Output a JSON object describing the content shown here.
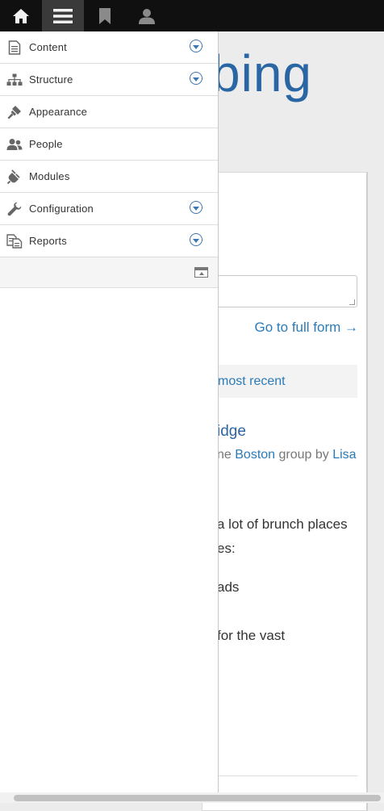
{
  "toolbar": {
    "items": [
      {
        "name": "home",
        "icon": "home-icon"
      },
      {
        "name": "manage",
        "icon": "hamburger-menu-icon"
      },
      {
        "name": "shortcuts",
        "icon": "bookmark-icon"
      },
      {
        "name": "user",
        "icon": "user-icon"
      }
    ]
  },
  "tray": {
    "items": [
      {
        "label": "Content",
        "icon": "document-icon",
        "has_children": true
      },
      {
        "label": "Structure",
        "icon": "sitemap-icon",
        "has_children": true
      },
      {
        "label": "Appearance",
        "icon": "paintbrush-icon",
        "has_children": false
      },
      {
        "label": "People",
        "icon": "people-icon",
        "has_children": false
      },
      {
        "label": "Modules",
        "icon": "plug-icon",
        "has_children": false
      },
      {
        "label": "Configuration",
        "icon": "wrench-icon",
        "has_children": true
      },
      {
        "label": "Reports",
        "icon": "reports-icon",
        "has_children": true
      }
    ]
  },
  "page": {
    "title_fragment": "bing",
    "full_form_link": "Go to full form →",
    "sort_fragment": "most recent",
    "post_title_fragment": "idge",
    "meta_prefix": "ne ",
    "meta_group": "Boston",
    "meta_middle": " group by ",
    "meta_author": "Lisa",
    "body_lines": [
      "a lot of brunch places",
      "es:",
      "ads",
      "for the vast"
    ]
  },
  "colors": {
    "toolbar_bg": "#101010",
    "link_blue": "#2a7bb8",
    "title_blue": "#2a66a3"
  }
}
